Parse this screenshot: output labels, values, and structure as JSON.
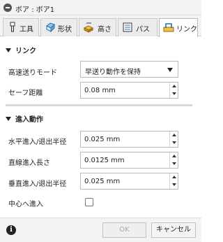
{
  "window": {
    "title": "ボア : ボア1"
  },
  "tabs": [
    {
      "label": "工具",
      "icon": "tool-icon"
    },
    {
      "label": "形状",
      "icon": "shape-icon"
    },
    {
      "label": "高さ",
      "icon": "height-icon"
    },
    {
      "label": "パス",
      "icon": "passes-icon"
    },
    {
      "label": "リンク",
      "icon": "linking-icon",
      "active": true
    }
  ],
  "linking": {
    "heading": "リンク",
    "rapid_mode_label": "高速送りモード",
    "rapid_mode_value": "早送り動作を保持",
    "safe_distance_label": "セーフ距離",
    "safe_distance_value": "0.08 mm"
  },
  "entry": {
    "heading": "進入動作",
    "horizontal_radius_label": "水平進入/退出半径",
    "horizontal_radius_value": "0.025 mm",
    "linear_length_label": "直線進入長さ",
    "linear_length_value": "0.0125 mm",
    "vertical_radius_label": "垂直進入/退出半径",
    "vertical_radius_value": "0.025 mm",
    "center_entry_label": "中心へ進入",
    "center_entry_checked": false
  },
  "footer": {
    "ok_label": "OK",
    "cancel_label": "キャンセル"
  }
}
